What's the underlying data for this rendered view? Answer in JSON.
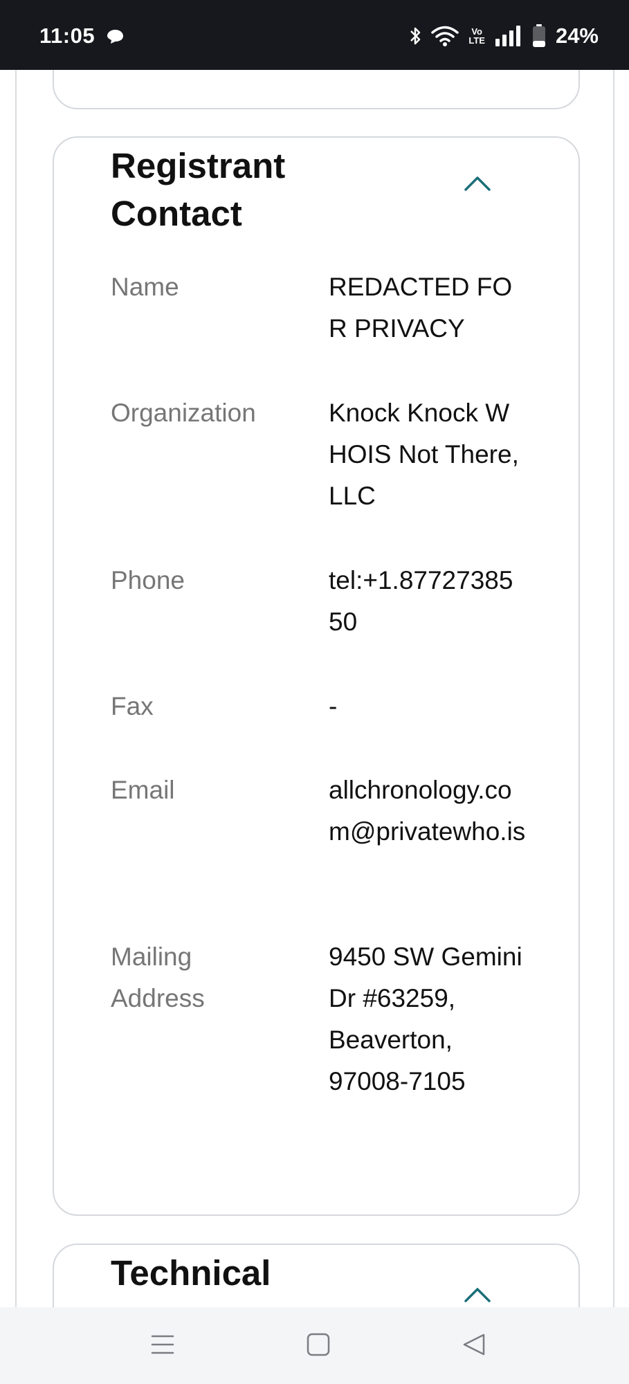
{
  "status_bar": {
    "time": "11:05",
    "volte_top": "Vo",
    "volte_bottom": "LTE",
    "battery": "24%",
    "icons": [
      "message-icon",
      "bluetooth-icon",
      "wifi-icon",
      "volte-icon",
      "signal-icon",
      "battery-icon"
    ]
  },
  "registrant_contact": {
    "title": "Registrant Contact",
    "fields": [
      {
        "label": "Name",
        "value": "REDACTED FOR PRIVACY"
      },
      {
        "label": "Organization",
        "value": "Knock Knock WHOIS Not There, LLC"
      },
      {
        "label": "Phone",
        "value": "tel:+1.8772738550"
      },
      {
        "label": "Fax",
        "value": "-"
      },
      {
        "label": "Email",
        "value": "allchronology.com@privatewho.is"
      },
      {
        "label": "Mailing Address",
        "value": "9450 SW Gemini Dr #63259, Beaverton, 97008-7105"
      }
    ]
  },
  "technical_contact": {
    "title": "Technical Contact"
  },
  "nav_bar": {
    "icons": [
      "menu-icon",
      "home-icon",
      "back-icon"
    ]
  },
  "colors": {
    "status_bar_bg": "#16181d",
    "accent_teal": "#1b6f78",
    "label_gray": "#767676",
    "card_border": "#d5d8dc"
  }
}
